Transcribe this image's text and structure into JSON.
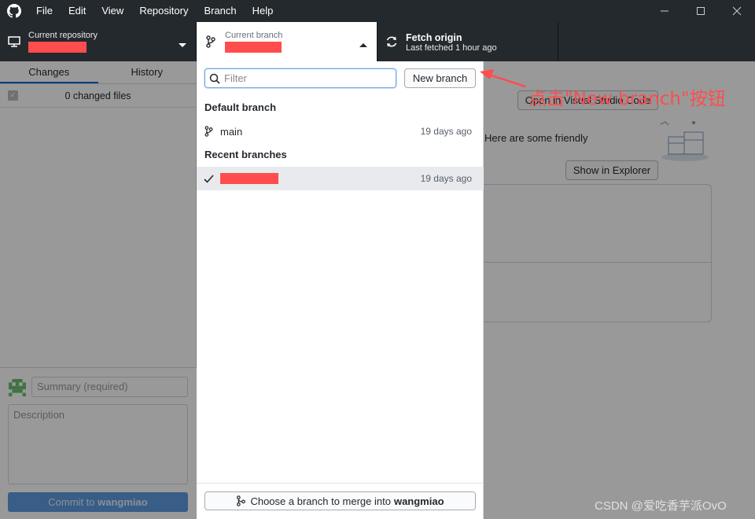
{
  "menu": [
    "File",
    "Edit",
    "View",
    "Repository",
    "Branch",
    "Help"
  ],
  "toolbar": {
    "repo_label": "Current repository",
    "branch_label": "Current branch",
    "fetch_title": "Fetch origin",
    "fetch_sub": "Last fetched 1 hour ago"
  },
  "sidebar": {
    "tabs": [
      "Changes",
      "History"
    ],
    "changed_files": "0 changed files",
    "summary_placeholder": "Summary (required)",
    "description_placeholder": "Description",
    "commit_prefix": "Commit to",
    "commit_branch": "wangmiao"
  },
  "main": {
    "friendly_text": "Here are some friendly",
    "open_editor_button": "Open in Visual Studio Code",
    "show_explorer_button": "Show in Explorer"
  },
  "dropdown": {
    "filter_placeholder": "Filter",
    "new_branch_button": "New branch",
    "default_header": "Default branch",
    "default_branch": {
      "name": "main",
      "time": "19 days ago"
    },
    "recent_header": "Recent branches",
    "recent_branch": {
      "time": "19 days ago"
    },
    "merge_prefix": "Choose a branch to merge into",
    "merge_branch": "wangmiao"
  },
  "annotation": {
    "text": "点击\"New branch\"按钮",
    "color": "#ff4d4d"
  },
  "watermark": "CSDN @爱吃香芋派OvO"
}
